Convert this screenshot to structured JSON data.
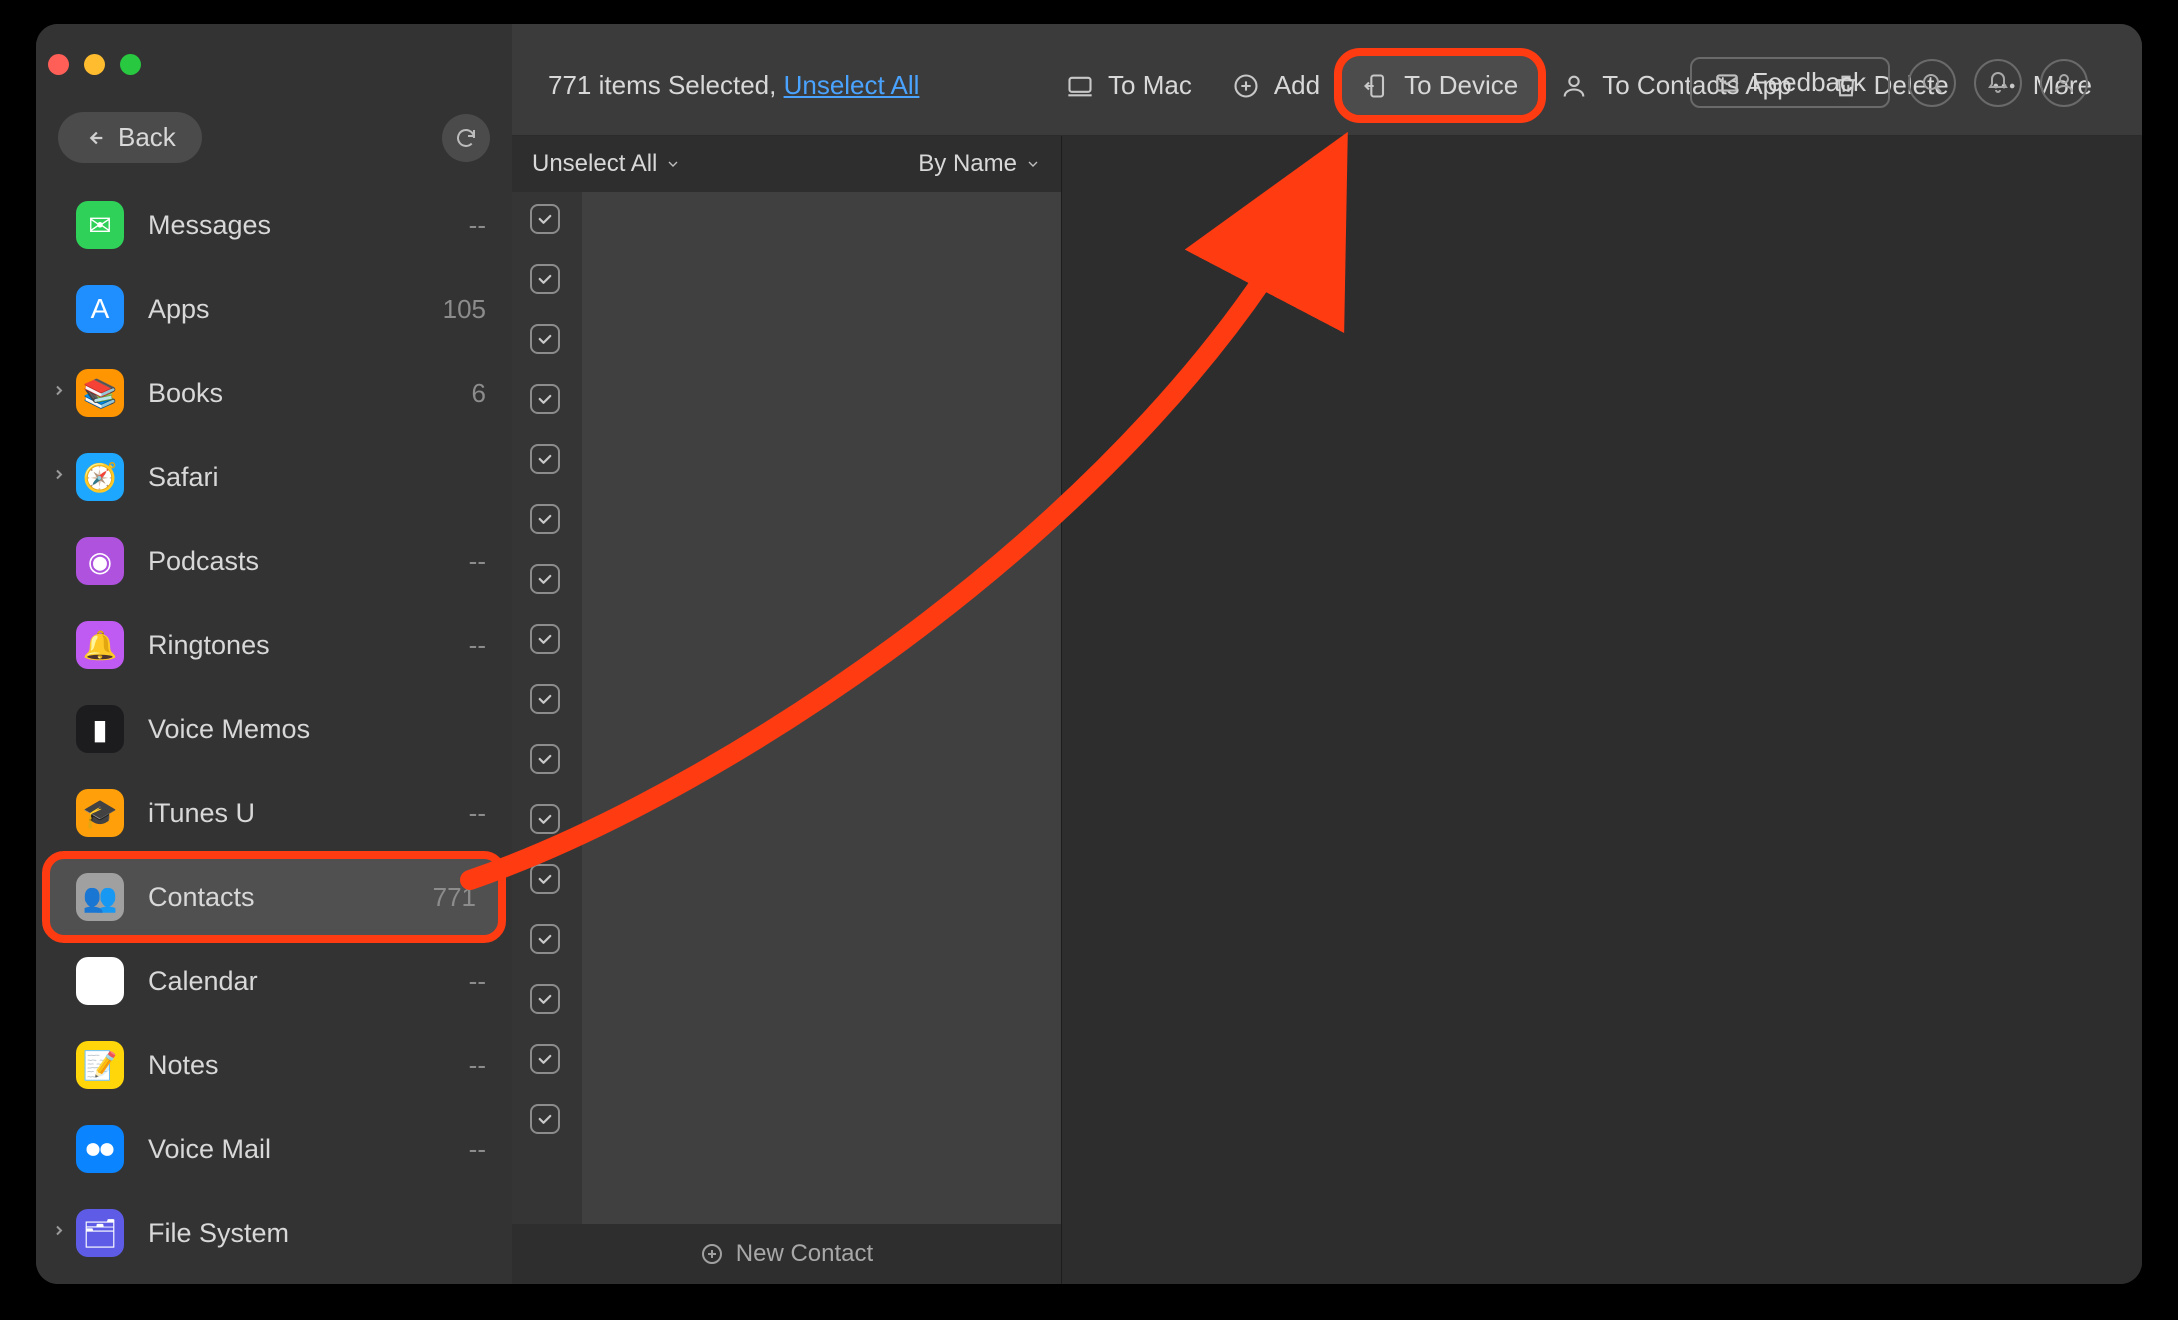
{
  "header": {
    "feedback": "Feedback"
  },
  "sidebar": {
    "back": "Back",
    "items": [
      {
        "label": "Messages",
        "count": "--",
        "icon": "messages",
        "color": "#30d158",
        "expandable": false
      },
      {
        "label": "Apps",
        "count": "105",
        "icon": "apps",
        "color": "#1f8fff",
        "expandable": false
      },
      {
        "label": "Books",
        "count": "6",
        "icon": "books",
        "color": "#ff9500",
        "expandable": true
      },
      {
        "label": "Safari",
        "count": "",
        "icon": "safari",
        "color": "#1ea7ff",
        "expandable": true
      },
      {
        "label": "Podcasts",
        "count": "--",
        "icon": "podcasts",
        "color": "#af52de",
        "expandable": false
      },
      {
        "label": "Ringtones",
        "count": "--",
        "icon": "ringtones",
        "color": "#bf5af2",
        "expandable": false
      },
      {
        "label": "Voice Memos",
        "count": "",
        "icon": "voicememos",
        "color": "#1c1c1e",
        "expandable": false
      },
      {
        "label": "iTunes U",
        "count": "--",
        "icon": "itunesu",
        "color": "#ff9f0a",
        "expandable": false
      },
      {
        "label": "Contacts",
        "count": "771",
        "icon": "contacts",
        "color": "#a0a0a0",
        "expandable": false,
        "highlighted": true
      },
      {
        "label": "Calendar",
        "count": "--",
        "icon": "calendar",
        "color": "#ffffff",
        "expandable": false
      },
      {
        "label": "Notes",
        "count": "--",
        "icon": "notes",
        "color": "#ffd60a",
        "expandable": false
      },
      {
        "label": "Voice Mail",
        "count": "--",
        "icon": "voicemail",
        "color": "#0a84ff",
        "expandable": false
      },
      {
        "label": "File System",
        "count": "",
        "icon": "filesystem",
        "color": "#5e5ce6",
        "expandable": true
      }
    ]
  },
  "topbar": {
    "selection_prefix": "771 items Selected, ",
    "unselect_link": "Unselect All",
    "actions": {
      "to_mac": "To Mac",
      "add": "Add",
      "to_device": "To Device",
      "to_contacts_app": "To Contacts App",
      "delete": "Delete",
      "more": "More"
    }
  },
  "listpane": {
    "unselect": "Unselect All",
    "sort": "By Name",
    "new_contact": "New Contact",
    "row_count": 16
  },
  "annotation": {
    "from": "sidebar-item-contacts",
    "to": "to-device-button",
    "color": "#ff3b12"
  }
}
